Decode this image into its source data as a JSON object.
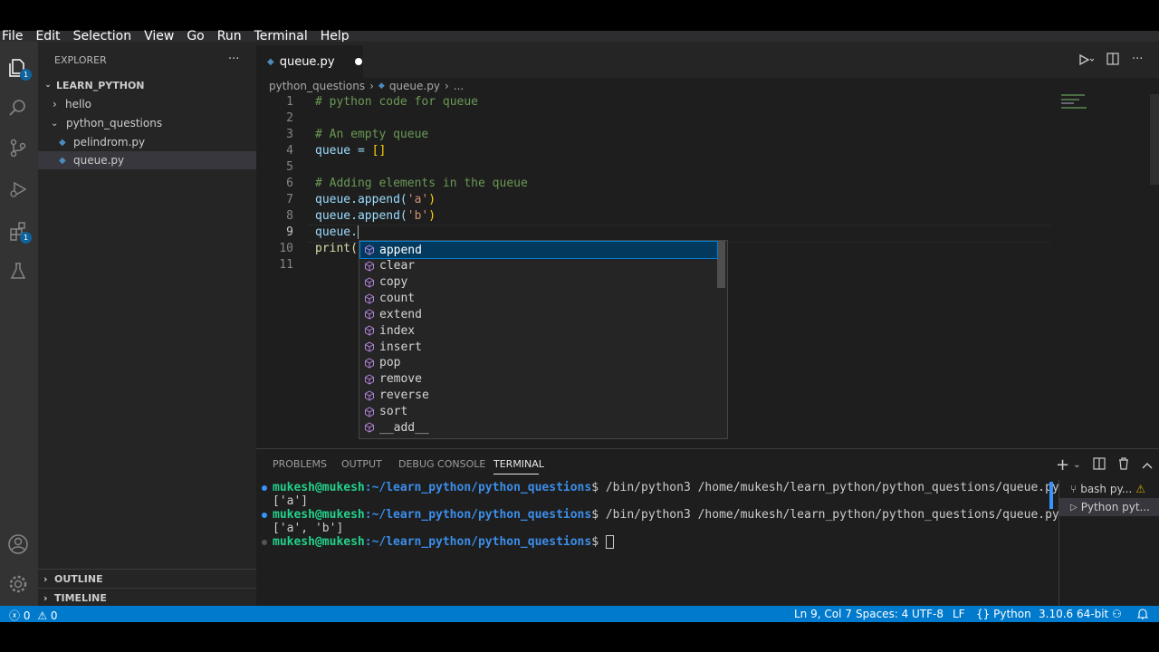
{
  "menu": [
    "File",
    "Edit",
    "Selection",
    "View",
    "Go",
    "Run",
    "Terminal",
    "Help"
  ],
  "sidebar": {
    "title": "EXPLORER",
    "more": "···",
    "root": "LEARN_PYTHON",
    "items": [
      {
        "label": "hello"
      },
      {
        "label": "python_questions"
      },
      {
        "label": "pelindrom.py"
      },
      {
        "label": "queue.py"
      }
    ],
    "outline": "OUTLINE",
    "timeline": "TIMELINE",
    "badges": {
      "explorer": "1",
      "extensions": "1"
    }
  },
  "editor": {
    "tab_label": "queue.py",
    "breadcrumb": [
      "python_questions",
      "queue.py",
      "..."
    ],
    "line_numbers": [
      "1",
      "2",
      "3",
      "4",
      "5",
      "6",
      "7",
      "8",
      "9",
      "10",
      "11"
    ],
    "lines": {
      "l1": "# python code for queue",
      "l3": "# An empty queue",
      "l4a": "queue = ",
      "l4b": "[]",
      "l6": "# Adding elements in the queue",
      "l7a": "queue.append(",
      "l7b": "'a'",
      "l7c": ")",
      "l8a": "queue.append(",
      "l8b": "'b'",
      "l8c": ")",
      "l9": "queue.",
      "l10": "print("
    },
    "suggestions": [
      "append",
      "clear",
      "copy",
      "count",
      "extend",
      "index",
      "insert",
      "pop",
      "remove",
      "reverse",
      "sort",
      "__add__"
    ]
  },
  "panel": {
    "tabs": [
      "PROBLEMS",
      "OUTPUT",
      "DEBUG CONSOLE",
      "TERMINAL"
    ],
    "active_tab": "TERMINAL",
    "terminal": {
      "user": "mukesh@mukesh",
      "path": ":~/learn_python/python_questions",
      "cmd": "$ /bin/python3 /home/mukesh/learn_python/python_questions/queue.py",
      "out1": "['a']",
      "out2": "['a', 'b']",
      "prompt_end": "$ "
    },
    "terminals": [
      "bash py...",
      "Python pyt..."
    ]
  },
  "status": {
    "errors": "0",
    "warnings": "0",
    "position": "Ln 9, Col 7",
    "spaces": "Spaces: 4",
    "encoding": "UTF-8",
    "eol": "LF",
    "language": "Python",
    "interpreter": "3.10.6 64-bit"
  },
  "colors": {
    "accent": "#007acc",
    "editor_bg": "#1e1e1e",
    "sidebar_bg": "#252526",
    "activity_bg": "#333333"
  }
}
